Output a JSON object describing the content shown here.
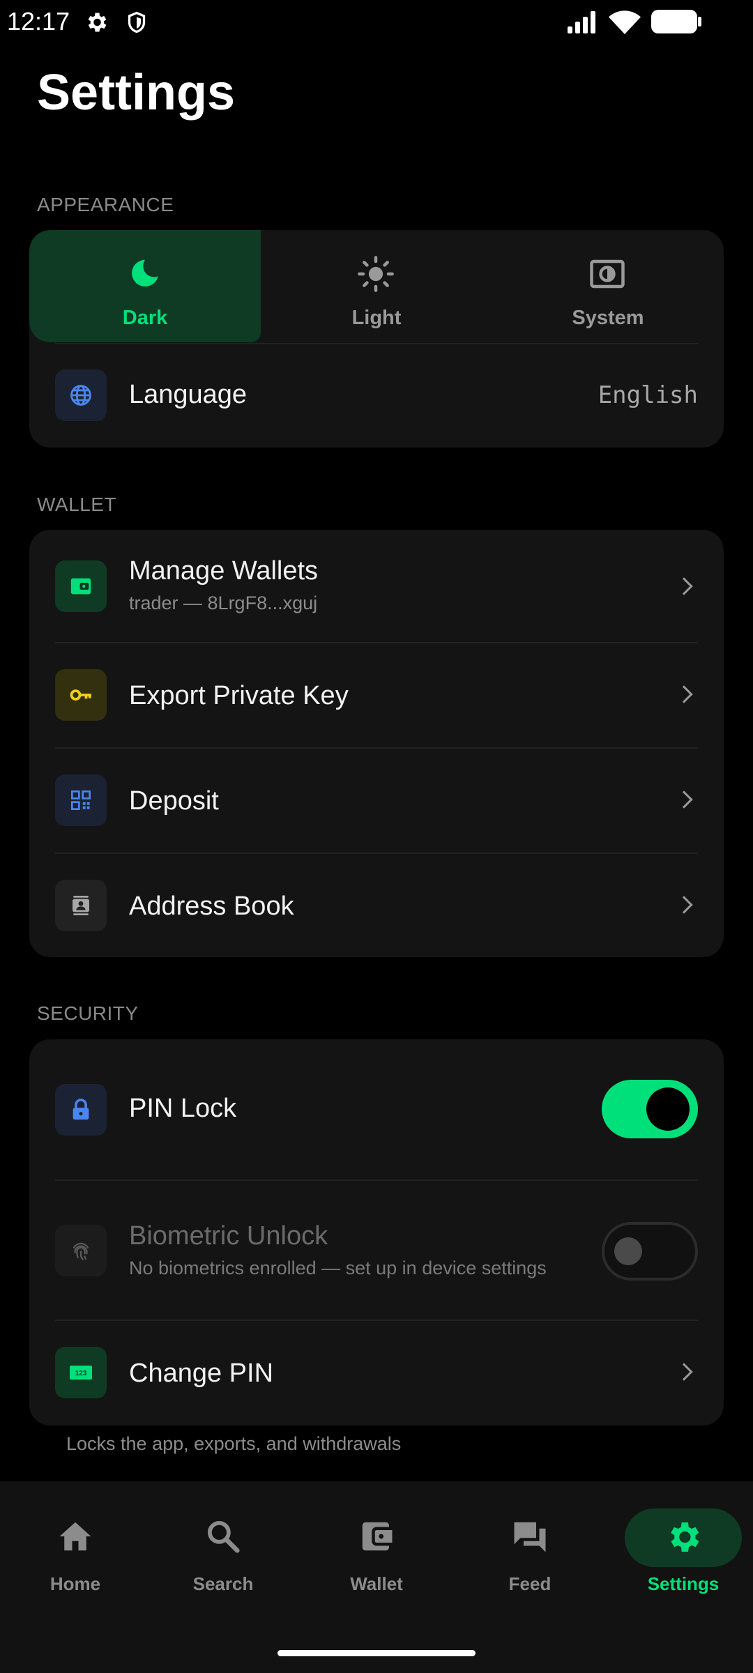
{
  "status_bar": {
    "time": "12:17"
  },
  "page": {
    "title": "Settings"
  },
  "colors": {
    "accent": "#00e07a",
    "background": "#000000",
    "card": "#141414"
  },
  "appearance": {
    "section_label": "APPEARANCE",
    "themes": [
      {
        "label": "Dark",
        "icon": "moon-icon",
        "selected": true
      },
      {
        "label": "Light",
        "icon": "sun-icon",
        "selected": false
      },
      {
        "label": "System",
        "icon": "brightness-auto-icon",
        "selected": false
      }
    ],
    "language": {
      "label": "Language",
      "value": "English",
      "icon": "globe-icon"
    }
  },
  "wallet": {
    "section_label": "WALLET",
    "items": [
      {
        "label": "Manage Wallets",
        "subtitle": "trader — 8LrgF8...xguj",
        "icon": "wallet-icon"
      },
      {
        "label": "Export Private Key",
        "icon": "key-icon"
      },
      {
        "label": "Deposit",
        "icon": "qr-code-icon"
      },
      {
        "label": "Address Book",
        "icon": "contacts-icon"
      }
    ]
  },
  "security": {
    "section_label": "SECURITY",
    "pin_lock": {
      "label": "PIN Lock",
      "enabled": true,
      "icon": "lock-icon"
    },
    "biometric": {
      "label": "Biometric Unlock",
      "subtitle": "No biometrics enrolled — set up in device settings",
      "enabled": false,
      "disabled": true,
      "icon": "fingerprint-icon"
    },
    "change_pin": {
      "label": "Change PIN",
      "icon": "pin-123-icon"
    },
    "footnote": "Locks the app, exports, and withdrawals"
  },
  "bottom_nav": {
    "items": [
      {
        "label": "Home",
        "icon": "home-icon",
        "active": false
      },
      {
        "label": "Search",
        "icon": "search-icon",
        "active": false
      },
      {
        "label": "Wallet",
        "icon": "wallet-icon",
        "active": false
      },
      {
        "label": "Feed",
        "icon": "chat-icon",
        "active": false
      },
      {
        "label": "Settings",
        "icon": "gear-icon",
        "active": true
      }
    ]
  }
}
